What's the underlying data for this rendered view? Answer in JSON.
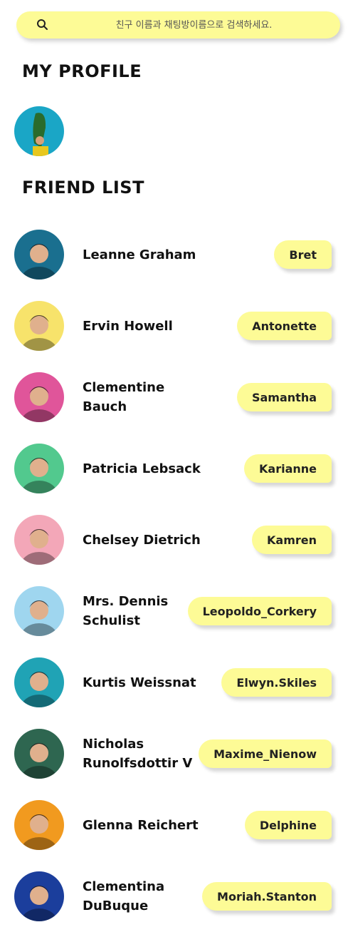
{
  "search": {
    "placeholder": "친구 이름과 채팅방이름으로 검색하세요."
  },
  "my_profile": {
    "title": "MY PROFILE"
  },
  "friend_list": {
    "title": "FRIEND LIST",
    "friends": [
      {
        "name": "Leanne Graham",
        "username": "Bret",
        "avatar_bg": "#1a6f8f"
      },
      {
        "name": "Ervin Howell",
        "username": "Antonette",
        "avatar_bg": "#f7e36b"
      },
      {
        "name": "Clementine Bauch",
        "username": "Samantha",
        "avatar_bg": "#e0559a"
      },
      {
        "name": "Patricia Lebsack",
        "username": "Karianne",
        "avatar_bg": "#52c98e"
      },
      {
        "name": "Chelsey Dietrich",
        "username": "Kamren",
        "avatar_bg": "#f3a7b8"
      },
      {
        "name": "Mrs. Dennis Schulist",
        "username": "Leopoldo_Corkery",
        "avatar_bg": "#9fd6ef"
      },
      {
        "name": "Kurtis Weissnat",
        "username": "Elwyn.Skiles",
        "avatar_bg": "#20a3b5"
      },
      {
        "name": "Nicholas Runolfsdottir V",
        "username": "Maxime_Nienow",
        "avatar_bg": "#2e6650"
      },
      {
        "name": "Glenna Reichert",
        "username": "Delphine",
        "avatar_bg": "#f19a1f"
      },
      {
        "name": "Clementina DuBuque",
        "username": "Moriah.Stanton",
        "avatar_bg": "#1b3e9c"
      }
    ]
  },
  "colors": {
    "accent": "#fdfb96",
    "text": "#111111"
  },
  "icons": {
    "search": "search-icon"
  }
}
